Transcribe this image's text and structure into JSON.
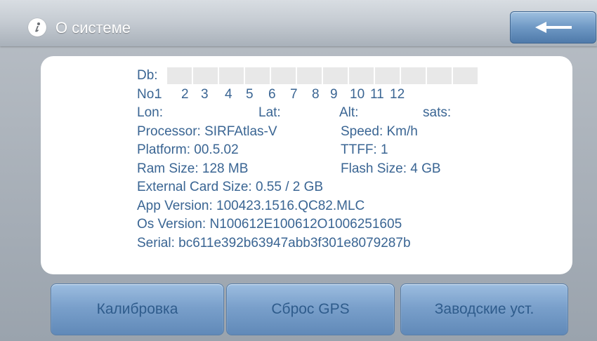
{
  "header": {
    "title": "О системе",
    "icon": "info-icon"
  },
  "back_button": {
    "icon": "back-arrow-icon"
  },
  "info": {
    "db_label": "Db:",
    "db_boxes": 12,
    "no_label": "No.",
    "numbers": [
      "1",
      "2",
      "3",
      "4",
      "5",
      "6",
      "7",
      "8",
      "9",
      "10",
      "11",
      "12"
    ],
    "lon_label": "Lon:",
    "lat_label": "Lat:",
    "alt_label": "Alt:",
    "sats_label": "sats:",
    "processor": "Processor: SIRFAtlas-V",
    "speed": "Speed: Km/h",
    "platform": "Platform: 00.5.02",
    "ttff": "TTFF:  1",
    "ram": "Ram Size: 128 MB",
    "flash": "Flash Size: 4 GB",
    "external_card": "External Card Size:  0.55 / 2 GB",
    "app_version": "App Version: 100423.1516.QC82.MLC",
    "os_version": "Os  Version: N100612E100612O1006251605",
    "serial": "Serial: bc611e392b63947abb3f301e8079287b"
  },
  "buttons": {
    "calibration": "Калибровка",
    "reset_gps": "Сброс GPS",
    "factory": "Заводские уст."
  },
  "colors": {
    "text": "#3a6593",
    "button_text": "#2f5c8c",
    "button_blue": "#7aa0cb"
  }
}
